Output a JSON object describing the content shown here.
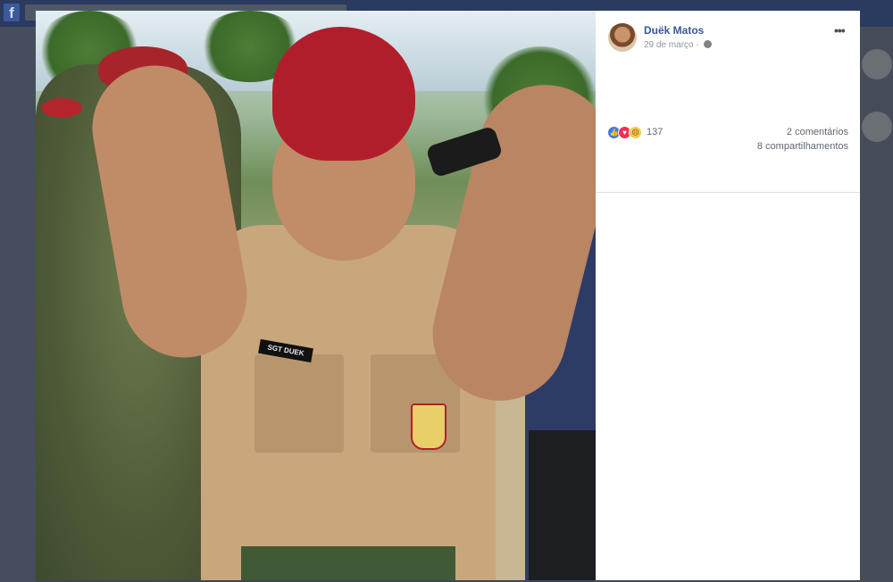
{
  "facebook": {
    "logo_letter": "f"
  },
  "post": {
    "author": "Duëk Matos",
    "date": "29 de março",
    "separator": "·",
    "privacy_icon": "globe-icon",
    "more_label": "•••"
  },
  "photo": {
    "name_tag": "SGT DUEK"
  },
  "reactions": {
    "icons": [
      "like-icon",
      "love-icon",
      "sad-icon"
    ],
    "count": "137",
    "comments": "2 comentários",
    "shares": "8 compartilhamentos"
  },
  "colors": {
    "link_blue": "#365899",
    "meta_gray": "#90949c",
    "like": "#3b7bf0",
    "love": "#f0304f",
    "sad": "#f7c84a"
  }
}
